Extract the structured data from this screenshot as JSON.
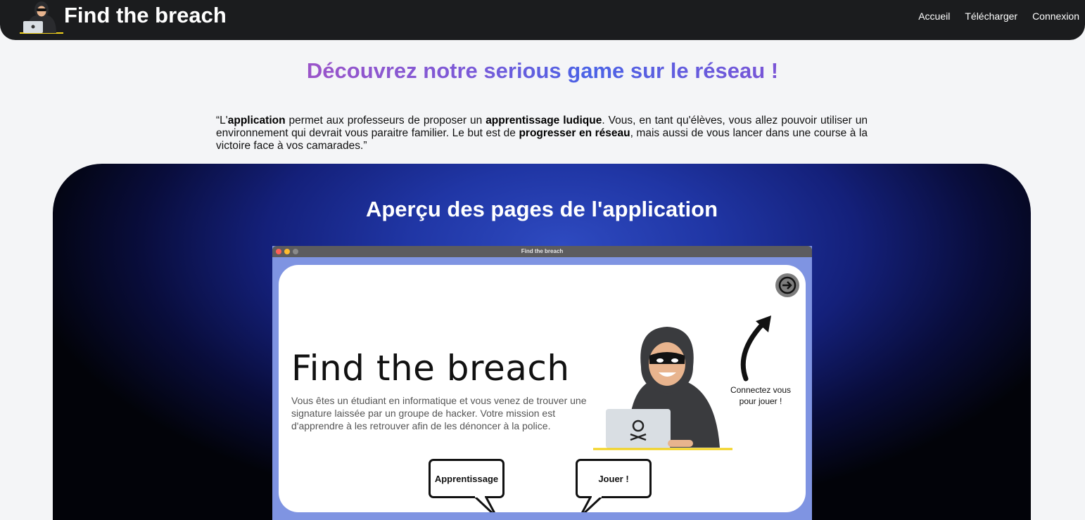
{
  "navbar": {
    "title": "Find the breach",
    "links": [
      "Accueil",
      "Télécharger",
      "Connexion"
    ]
  },
  "headline": "Découvrez notre serious game sur le réseau !",
  "quote": {
    "q_open": "“L'",
    "b1": "application",
    "t1": " permet aux professeurs de proposer un ",
    "b2": "apprentissage ludique",
    "t2": ". Vous, en tant qu'élèves, vous allez pouvoir utiliser un environnement qui devrait vous paraitre familier. Le but est de ",
    "b3": "progresser en réseau",
    "t3": ", mais aussi de vous lancer dans une course à la victoire face à vos camarades.”"
  },
  "preview": {
    "section_title": "Aperçu des pages de l'application",
    "window_title": "Find the breach",
    "card_title": "Find the breach",
    "card_description": "Vous êtes un étudiant en informatique et vous venez de trouver une signature laissée par un groupe de hacker. Votre mission est d'apprendre à les retrouver afin de les dénoncer à la police.",
    "connect_line1": "Connectez vous",
    "connect_line2": "pour  jouer !",
    "learn_button": "Apprentissage",
    "play_button": "Jouer !"
  },
  "icons": {
    "logo": "hacker-logo-icon",
    "login": "login-arrow-icon"
  },
  "colors": {
    "navbar_bg": "#1b1c1e",
    "page_bg": "#f4f5f7",
    "window_bg": "#7f94e2",
    "accent_yellow": "#f2d21c"
  }
}
